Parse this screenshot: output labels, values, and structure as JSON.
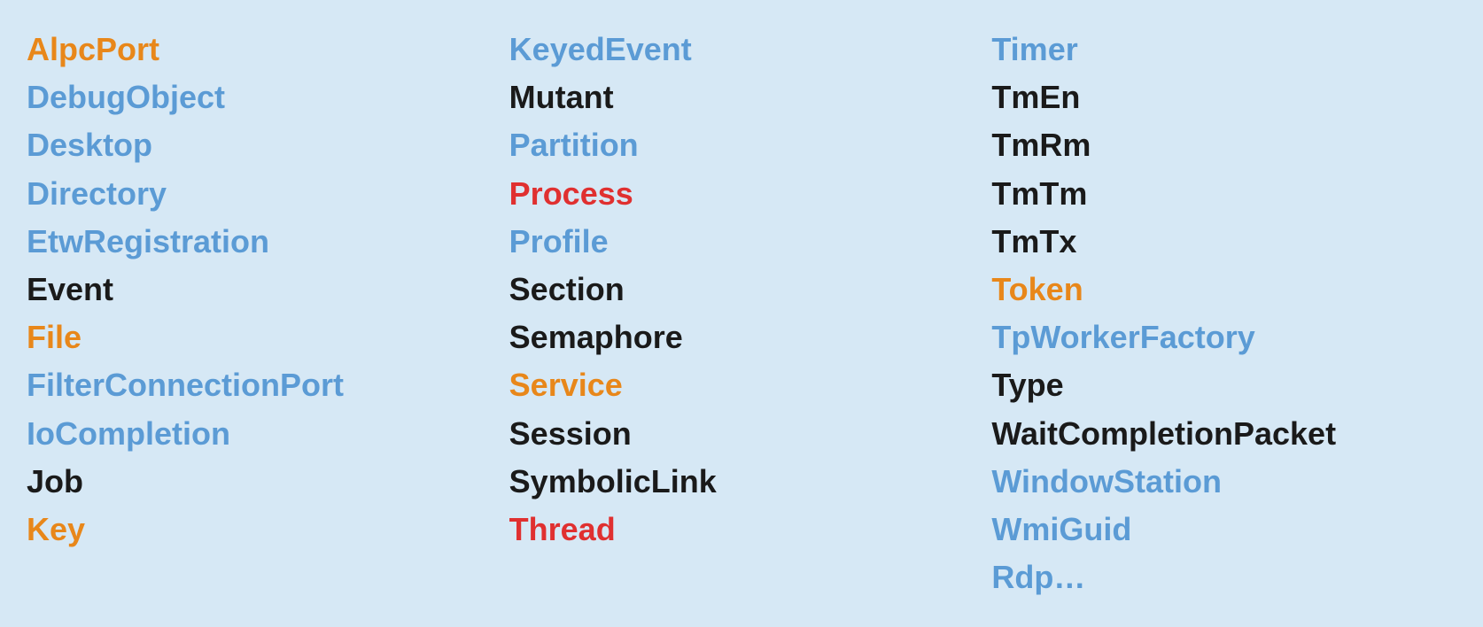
{
  "columns": [
    {
      "id": "col1",
      "items": [
        {
          "label": "AlpcPort",
          "color": "orange"
        },
        {
          "label": "DebugObject",
          "color": "blue"
        },
        {
          "label": "Desktop",
          "color": "blue"
        },
        {
          "label": "Directory",
          "color": "blue"
        },
        {
          "label": "EtwRegistration",
          "color": "blue"
        },
        {
          "label": "Event",
          "color": "black"
        },
        {
          "label": "File",
          "color": "orange"
        },
        {
          "label": "FilterConnectionPort",
          "color": "blue"
        },
        {
          "label": "IoCompletion",
          "color": "blue"
        },
        {
          "label": "Job",
          "color": "black"
        },
        {
          "label": "Key",
          "color": "orange"
        }
      ]
    },
    {
      "id": "col2",
      "items": [
        {
          "label": "KeyedEvent",
          "color": "blue"
        },
        {
          "label": "Mutant",
          "color": "black"
        },
        {
          "label": "Partition",
          "color": "blue"
        },
        {
          "label": "Process",
          "color": "red"
        },
        {
          "label": "Profile",
          "color": "blue"
        },
        {
          "label": "Section",
          "color": "black"
        },
        {
          "label": "Semaphore",
          "color": "black"
        },
        {
          "label": "Service",
          "color": "orange"
        },
        {
          "label": "Session",
          "color": "black"
        },
        {
          "label": "SymbolicLink",
          "color": "black"
        },
        {
          "label": "Thread",
          "color": "red"
        }
      ]
    },
    {
      "id": "col3",
      "items": [
        {
          "label": "Timer",
          "color": "blue"
        },
        {
          "label": "TmEn",
          "color": "black"
        },
        {
          "label": "TmRm",
          "color": "black"
        },
        {
          "label": "TmTm",
          "color": "black"
        },
        {
          "label": "TmTx",
          "color": "black"
        },
        {
          "label": "Token",
          "color": "orange"
        },
        {
          "label": "TpWorkerFactory",
          "color": "blue"
        },
        {
          "label": "Type",
          "color": "black"
        },
        {
          "label": "WaitCompletionPacket",
          "color": "black"
        },
        {
          "label": "WindowStation",
          "color": "blue"
        },
        {
          "label": "WmiGuid",
          "color": "blue"
        },
        {
          "label": "Rdp…",
          "color": "blue"
        }
      ]
    }
  ],
  "colors": {
    "orange": "#e8871a",
    "blue": "#5b9bd5",
    "black": "#1a1a1a",
    "red": "#e03030"
  }
}
